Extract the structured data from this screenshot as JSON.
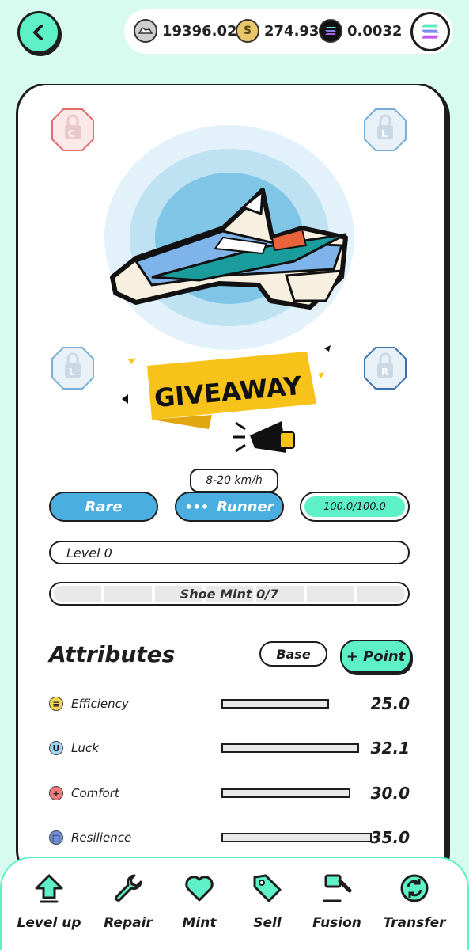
{
  "header": {
    "balances": [
      {
        "icon": "sneaker-token-icon",
        "value": "19396.02"
      },
      {
        "icon": "gold-coin-icon",
        "value": "274.93"
      },
      {
        "icon": "solana-icon",
        "value": "0.0032"
      }
    ]
  },
  "shoe": {
    "badge_text": "GIVEAWAY",
    "slots": {
      "top_left": "C",
      "top_right": "L",
      "mid_left": "L",
      "mid_right": "R"
    },
    "speed_range": "8-20 km/h",
    "rarity": "Rare",
    "type": "Runner",
    "durability": "100.0/100.0",
    "durability_fraction": 1.0,
    "level": "Level 0",
    "mint": "Shoe Mint 0/7"
  },
  "attributes": {
    "title": "Attributes",
    "base_label": "Base",
    "point_label": "+ Point",
    "items": [
      {
        "name": "Efficiency",
        "value": "25.0",
        "color": "#f3d44e",
        "symbol": "≡"
      },
      {
        "name": "Luck",
        "value": "32.1",
        "color": "#9ad7ef",
        "symbol": "U"
      },
      {
        "name": "Comfort",
        "value": "30.0",
        "color": "#f07a7a",
        "symbol": "+"
      },
      {
        "name": "Resilience",
        "value": "35.0",
        "color": "#6f8ed8",
        "symbol": "□"
      }
    ]
  },
  "nav": {
    "items": [
      {
        "label": "Level up",
        "icon": "arrow-up-icon"
      },
      {
        "label": "Repair",
        "icon": "wrench-icon"
      },
      {
        "label": "Mint",
        "icon": "heart-icon"
      },
      {
        "label": "Sell",
        "icon": "tag-icon"
      },
      {
        "label": "Fusion",
        "icon": "hammer-icon"
      },
      {
        "label": "Transfer",
        "icon": "transfer-icon"
      }
    ]
  },
  "colors": {
    "accent": "#5ef0c6",
    "rare_blue": "#4aaee0",
    "background": "#d8fbef"
  }
}
